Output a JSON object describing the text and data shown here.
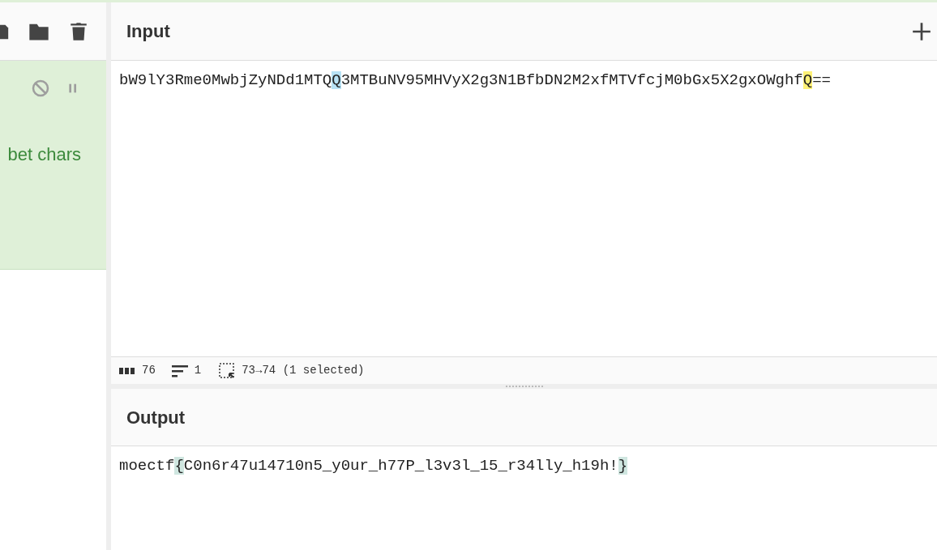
{
  "recipe": {
    "operation_text": "bet chars",
    "disabled": false,
    "paused": false
  },
  "input": {
    "title": "Input",
    "segments": [
      {
        "text": "bW9lY3Rme0MwbjZyNDd1MTQ",
        "highlighted": false
      },
      {
        "text": "Q",
        "highlighted": true,
        "color": "#b8e2f5"
      },
      {
        "text": "3MTBuNV95MHVyX2g3N1BfbDN2M2xfMTVfcjM0bGx5X2gxOWghf",
        "highlighted": false
      },
      {
        "text": "Q",
        "highlighted": true,
        "color": "#fff176"
      },
      {
        "text": "==",
        "highlighted": false
      }
    ]
  },
  "status_bar": {
    "length": "76",
    "lines": "1",
    "selection": "73→74 (1 selected)"
  },
  "output": {
    "title": "Output",
    "segments": [
      {
        "text": "moectf",
        "highlighted": false
      },
      {
        "text": "{",
        "highlighted": true,
        "color": "#cfe6e0"
      },
      {
        "text": "C0n6r47u14710n5_y0ur_h77P_l3v3l_15_r34lly_h19h!",
        "highlighted": false
      },
      {
        "text": "}",
        "highlighted": true,
        "color": "#cfe6e0"
      }
    ]
  }
}
